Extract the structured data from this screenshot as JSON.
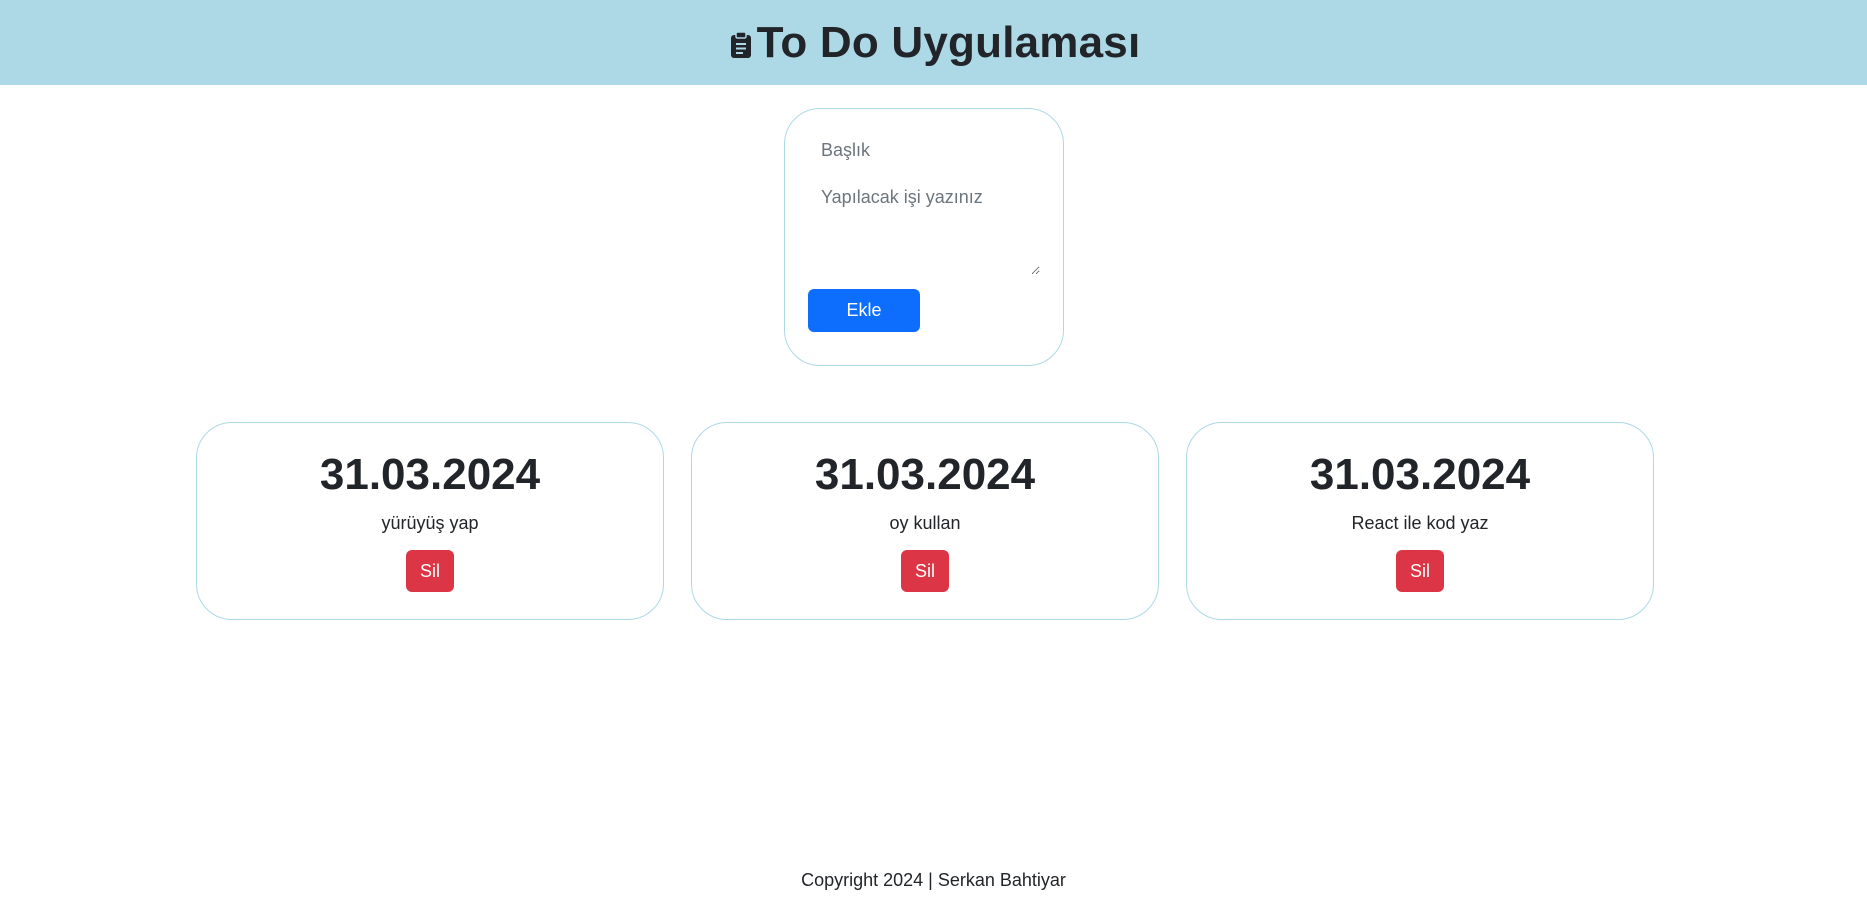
{
  "header": {
    "icon": "clipboard-icon",
    "title": "To Do Uygulaması",
    "background_color": "#add8e6"
  },
  "form": {
    "title_placeholder": "Başlık",
    "task_placeholder": "Yapılacak işi yazınız",
    "add_label": "Ekle",
    "add_button_color": "#0d6efd"
  },
  "todos": [
    {
      "date": "31.03.2024",
      "text": "yürüyüş yap",
      "delete_label": "Sil"
    },
    {
      "date": "31.03.2024",
      "text": "oy kullan",
      "delete_label": "Sil"
    },
    {
      "date": "31.03.2024",
      "text": "React ile kod yaz",
      "delete_label": "Sil"
    }
  ],
  "delete_button_color": "#dc3545",
  "card_border_color": "#add8e6",
  "footer": {
    "text": "Copyright 2024 | Serkan Bahtiyar"
  }
}
